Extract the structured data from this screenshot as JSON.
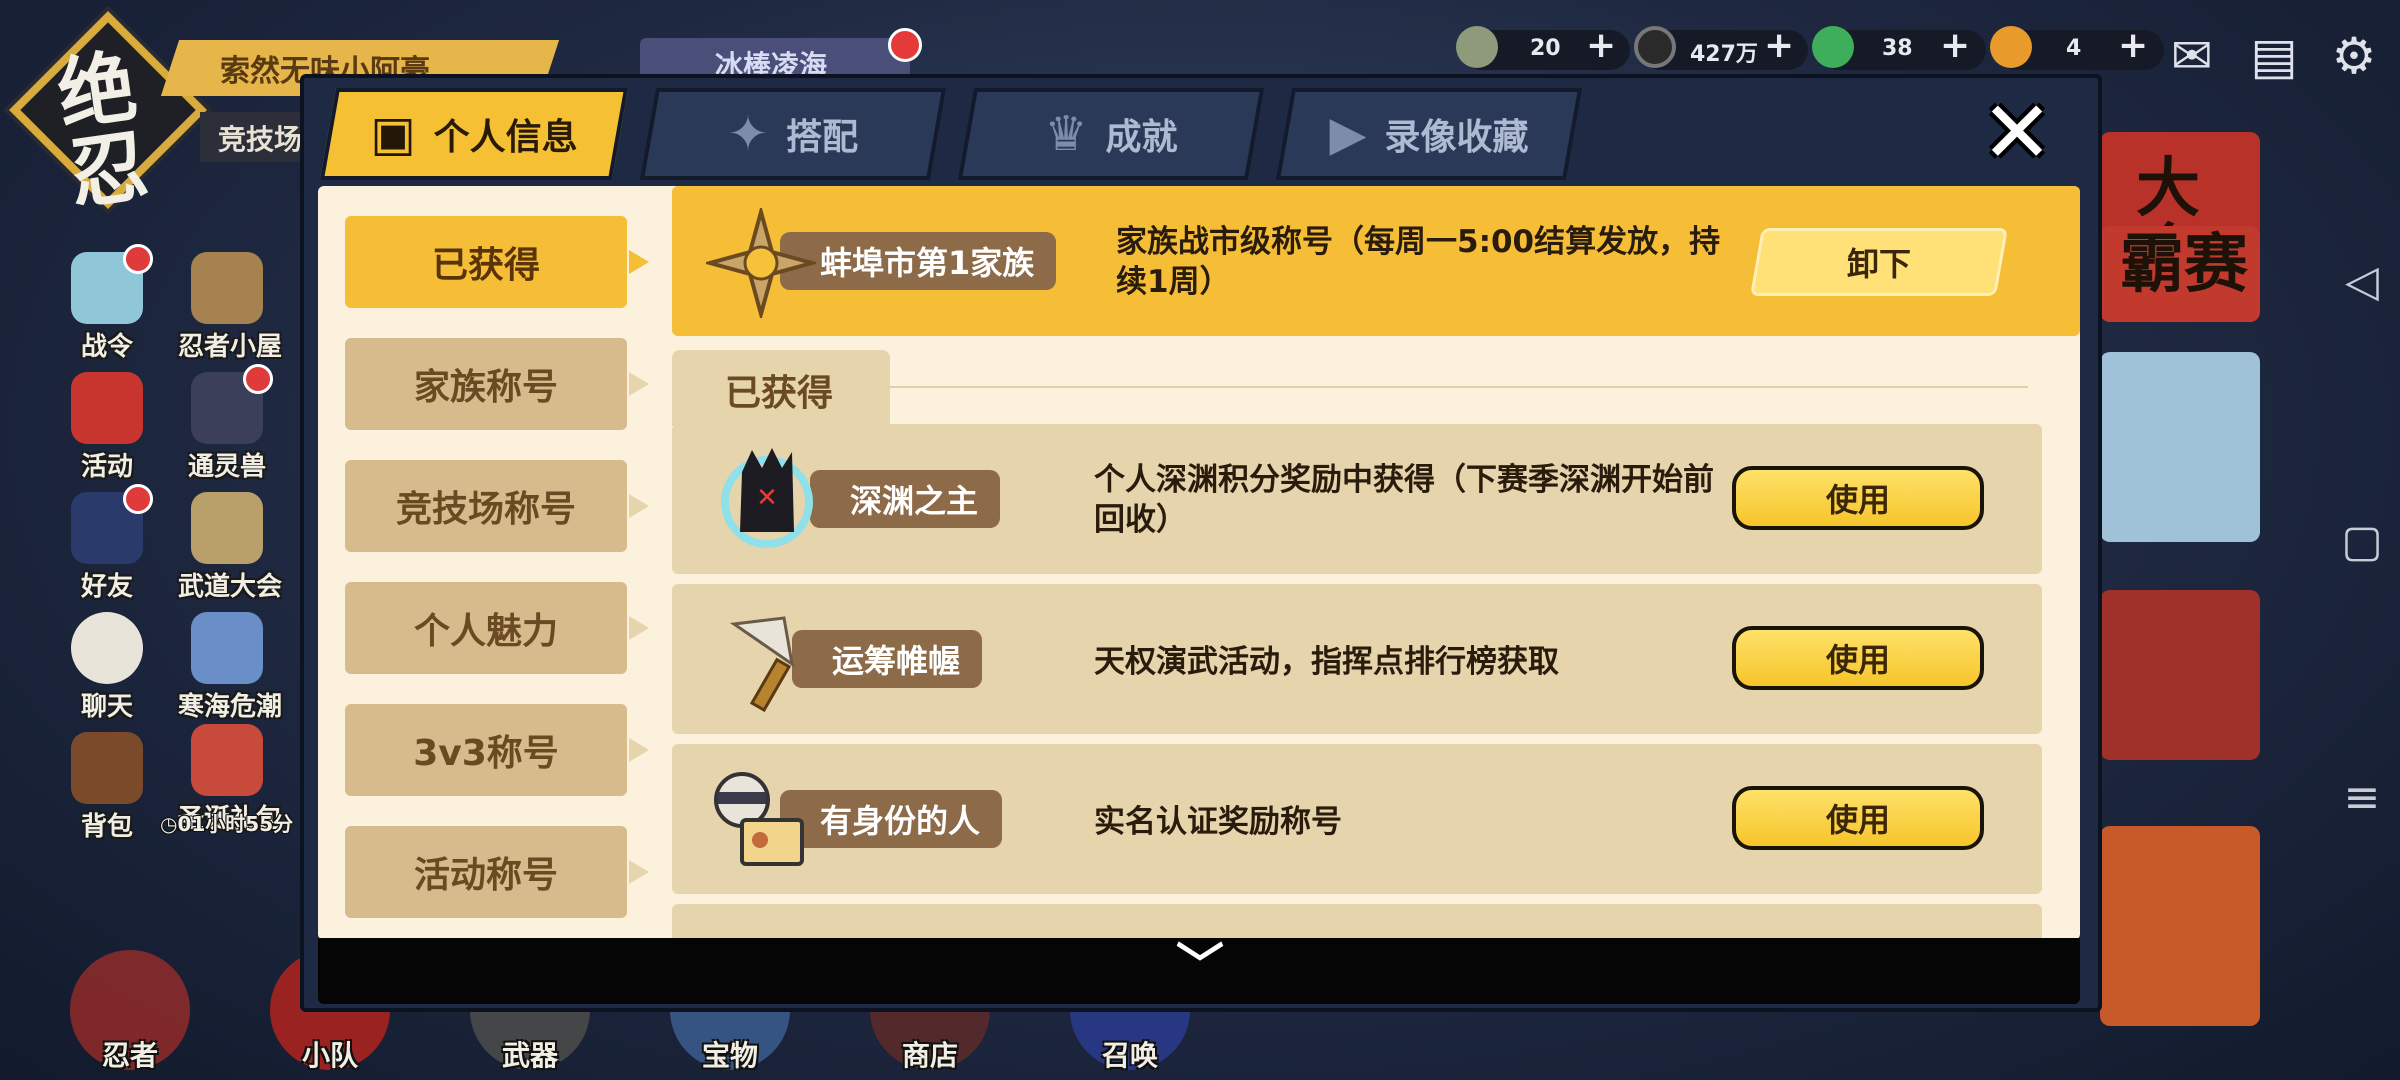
{
  "background": {
    "logo_text": "绝忍",
    "player_name": "索然无味小阿豪",
    "player_sub": "竞技场",
    "event_banner": "冰棒凌海",
    "resources": [
      {
        "icon": "rice-ball-icon",
        "value": "20"
      },
      {
        "icon": "coin-icon",
        "value": "427万"
      },
      {
        "icon": "green-magatama-icon",
        "value": "38"
      },
      {
        "icon": "orange-magatama-icon",
        "value": "4"
      }
    ],
    "top_buttons": [
      "mail-icon",
      "shop-icon",
      "settings-icon"
    ],
    "side_icons": [
      {
        "label": "战令",
        "badge": true
      },
      {
        "label": "忍者小屋",
        "badge": false
      },
      {
        "label": "活动",
        "badge": false
      },
      {
        "label": "通灵兽",
        "badge": true
      },
      {
        "label": "好友",
        "badge": true
      },
      {
        "label": "武道大会",
        "badge": false
      },
      {
        "label": "聊天",
        "badge": false
      },
      {
        "label": "寒海危潮",
        "badge": false
      },
      {
        "label": "背包",
        "badge": false
      },
      {
        "label": "圣诞礼包",
        "badge": false
      }
    ],
    "side_timer": "◷01小时55分",
    "bottom_nav": [
      "忍者",
      "小队",
      "武器",
      "宝物",
      "商店",
      "召唤"
    ],
    "right_card_texts": [
      "大会",
      "霸赛"
    ]
  },
  "modal": {
    "tabs": [
      {
        "label": "个人信息",
        "icon": "ninja-card-icon",
        "active": true
      },
      {
        "label": "搭配",
        "icon": "shuriken-icon",
        "active": false
      },
      {
        "label": "成就",
        "icon": "trophy-icon",
        "active": false
      },
      {
        "label": "录像收藏",
        "icon": "play-icon",
        "active": false
      }
    ],
    "close_label": "✕",
    "categories": [
      {
        "label": "已获得",
        "active": true
      },
      {
        "label": "家族称号",
        "active": false
      },
      {
        "label": "竞技场称号",
        "active": false
      },
      {
        "label": "个人魅力",
        "active": false
      },
      {
        "label": "3v3称号",
        "active": false
      },
      {
        "label": "活动称号",
        "active": false
      }
    ],
    "equipped": {
      "title": "蚌埠市第1家族",
      "description": "家族战市级称号（每周一5:00结算发放，持续1周）",
      "button": "卸下"
    },
    "section_label": "已获得",
    "titles": [
      {
        "title": "深渊之主",
        "description": "个人深渊积分奖励中获得（下赛季深渊开始前回收）",
        "button": "使用"
      },
      {
        "title": "运筹帷幄",
        "description": "天权演武活动，指挥点排行榜获取",
        "button": "使用"
      },
      {
        "title": "有身份的人",
        "description": "实名认证奖励称号",
        "button": "使用"
      }
    ],
    "scroll_hint": "﹀"
  },
  "colors": {
    "accent": "#f5c033",
    "panel": "#fbf1dc",
    "row": "#e6d4ad",
    "badge_brown": "#8d6a48"
  }
}
